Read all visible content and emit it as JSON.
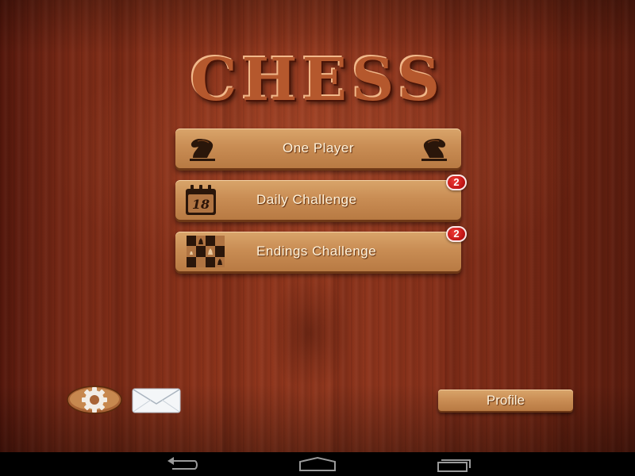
{
  "title": "CHESS",
  "menu": {
    "one_player": {
      "label": "One Player",
      "icon": "knight-icon"
    },
    "daily_challenge": {
      "label": "Daily Challenge",
      "icon": "calendar-icon",
      "calendar_day": "18",
      "badge": "2"
    },
    "endings_challenge": {
      "label": "Endings Challenge",
      "icon": "chessboard-icon",
      "badge": "2"
    }
  },
  "footer": {
    "settings_icon": "gear-icon",
    "messages_icon": "envelope-icon",
    "profile_label": "Profile"
  },
  "navigation": {
    "back_icon": "back-arrow-icon",
    "home_icon": "home-icon",
    "recent_icon": "recent-apps-icon"
  },
  "colors": {
    "wood_background": "#8a321a",
    "button_wood": "#c98d54",
    "badge_red": "#c01414",
    "title_wood": "#b5582d"
  }
}
